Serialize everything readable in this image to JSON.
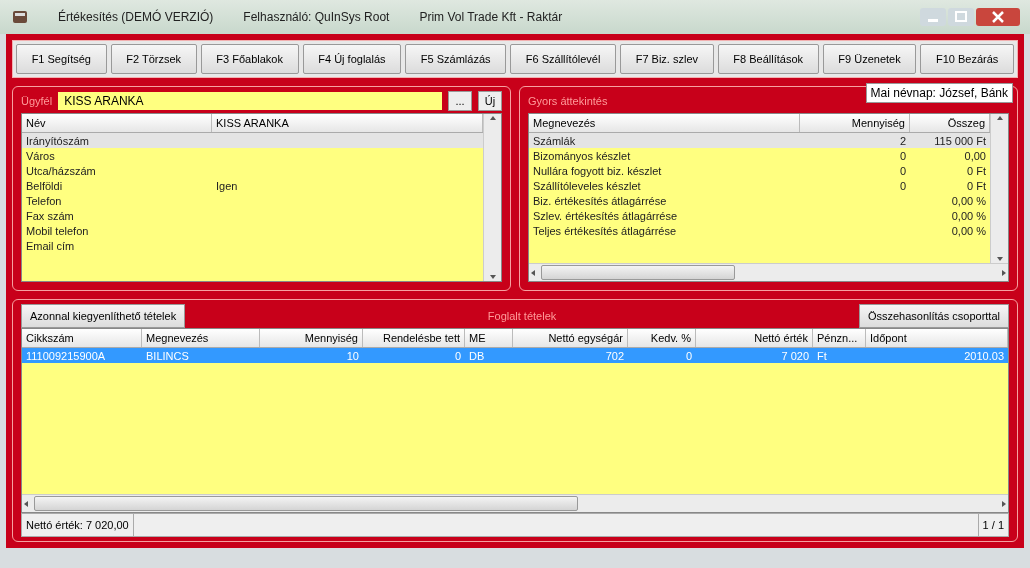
{
  "window": {
    "title": "Értékesítés (DEMÓ VERZIÓ)",
    "user": "Felhasználó: QuInSys Root",
    "company": "Prim Vol Trade Kft - Raktár"
  },
  "toolbar": [
    "F1 Segítség",
    "F2 Törzsek",
    "F3 Főablakok",
    "F4 Új foglalás",
    "F5 Számlázás",
    "F6 Szállítólevél",
    "F7 Biz. szlev",
    "F8 Beállítások",
    "F9 Üzenetek",
    "F10 Bezárás"
  ],
  "customer": {
    "title": "Ügyfél",
    "value": "KISS ARANKA",
    "browse_button": "...",
    "new_button": "Új",
    "columns": [
      "Név",
      "KISS ARANKA"
    ],
    "rows": [
      {
        "label": "Irányítószám",
        "value": "",
        "selected": true
      },
      {
        "label": "Város",
        "value": "",
        "selected": false
      },
      {
        "label": "Utca/házszám",
        "value": "",
        "selected": false
      },
      {
        "label": "Belföldi",
        "value": "Igen",
        "selected": false
      },
      {
        "label": "Telefon",
        "value": "",
        "selected": false
      },
      {
        "label": "Fax szám",
        "value": "",
        "selected": false
      },
      {
        "label": "Mobil telefon",
        "value": "",
        "selected": false
      },
      {
        "label": "Email cím",
        "value": "",
        "selected": false
      }
    ]
  },
  "nameday": "Mai névnap: József, Bánk",
  "overview": {
    "title": "Gyors áttekintés",
    "columns": [
      "Megnevezés",
      "Mennyiség",
      "Összeg"
    ],
    "rows": [
      {
        "cells": [
          "Számlák",
          "2",
          "115 000 Ft"
        ],
        "selected": true
      },
      {
        "cells": [
          "Bizományos készlet",
          "0",
          "0,00"
        ],
        "selected": false
      },
      {
        "cells": [
          "Nullára fogyott biz. készlet",
          "0",
          "0 Ft"
        ],
        "selected": false
      },
      {
        "cells": [
          "Szállítóleveles készlet",
          "0",
          "0 Ft"
        ],
        "selected": false
      },
      {
        "cells": [
          "Biz. értékesítés átlagárrése",
          "",
          "0,00 %"
        ],
        "selected": false
      },
      {
        "cells": [
          "Szlev. értékesítés átlagárrése",
          "",
          "0,00 %"
        ],
        "selected": false
      },
      {
        "cells": [
          "Teljes értékesítés átlagárrése",
          "",
          "0,00 %"
        ],
        "selected": false
      }
    ]
  },
  "reserved": {
    "title": "Foglalt tételek",
    "left_button": "Azonnal kiegyenlíthető tételek",
    "right_button": "Összehasonlítás csoporttal",
    "columns": [
      "Cikkszám",
      "Megnevezés",
      "Mennyiség",
      "Rendelésbe tett",
      "ME",
      "Nettó egységár",
      "Kedv. %",
      "Nettó érték",
      "Pénzn...",
      "Időpont"
    ],
    "rows": [
      {
        "cells": [
          "111009215900A",
          "BILINCS",
          "10",
          "0",
          "DB",
          "702",
          "0",
          "7 020",
          "Ft",
          "2010.03"
        ],
        "selected": true
      }
    ]
  },
  "status_bar": {
    "total": "Nettó érték: 7 020,00",
    "pages": "1 / 1"
  }
}
